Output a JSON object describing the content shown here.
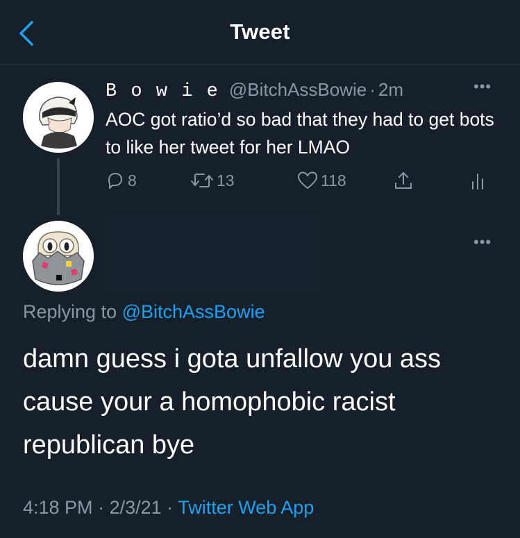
{
  "header": {
    "title": "Tweet",
    "accent": "#1da1f2"
  },
  "original_tweet": {
    "display_name": "B o w i e",
    "handle": "@BitchAssBowie",
    "separator": "·",
    "time": "2m",
    "text": "AOC got ratio’d so bad that they had to get bots to like her tweet for her LMAO",
    "actions": {
      "replies": "8",
      "retweets": "13",
      "likes": "118"
    }
  },
  "reply": {
    "replying_prefix": "Replying to",
    "replying_handle": "@BitchAssBowie",
    "text": "damn guess i gota unfallow you ass cause your a homophobic racist republican bye",
    "time": "4:18 PM",
    "separator": "·",
    "date": "2/3/21",
    "separator2": "·",
    "source": "Twitter Web App"
  },
  "colors": {
    "background": "#15202b",
    "secondary_text": "#8899a6",
    "link": "#1da1f2",
    "divider": "#38444d"
  }
}
